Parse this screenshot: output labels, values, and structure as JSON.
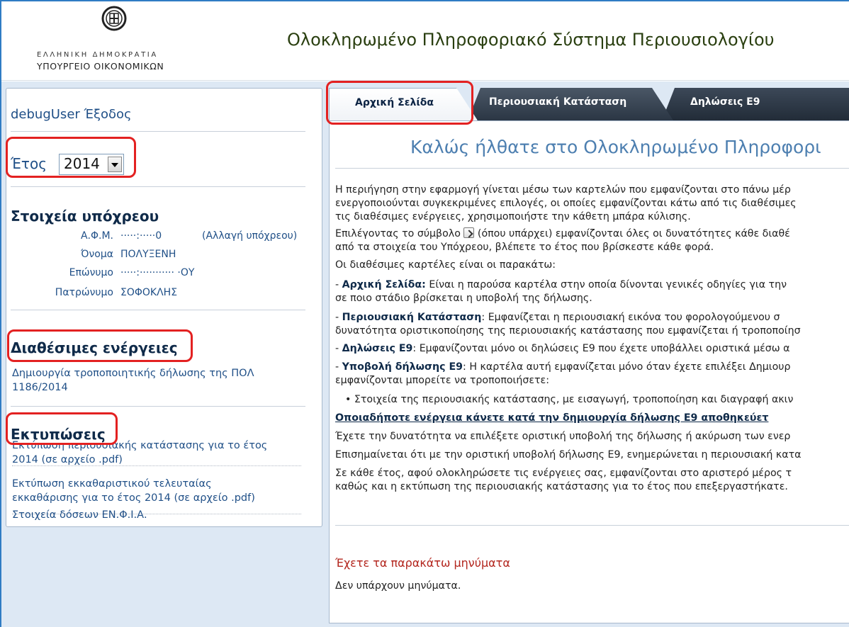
{
  "header": {
    "logo_line1": "ΕΛΛΗΝΙΚΗ ΔΗΜΟΚΡΑΤΙΑ",
    "logo_line2": "ΥΠΟΥΡΓΕΙΟ ΟΙΚΟΝΟΜΙΚΩΝ",
    "app_title": "Ολοκληρωμένο Πληροφοριακό Σύστημα Περιουσιολογίου"
  },
  "sidebar": {
    "user": "debugUser",
    "logout": "Έξοδος",
    "year_label": "Έτος",
    "year_value": "2014",
    "taxpayer_title": "Στοιχεία υπόχρεου",
    "taxpayer": {
      "afm_label": "Α.Φ.Μ.",
      "afm_value": "·····:·····0",
      "change_link": "(Αλλαγή υπόχρεου)",
      "name_label": "Όνομα",
      "name_value": "ΠΟΛΥΞΕΝΗ",
      "surname_label": "Επώνυμο",
      "surname_value": "·····:··········· ·ΟΥ",
      "father_label": "Πατρώνυμο",
      "father_value": "ΣΟΦΟΚΛΗΣ"
    },
    "actions_title": "Διαθέσιμες ενέργειες",
    "actions": [
      {
        "line1": "Δημιουργία τροποποιητικής δήλωσης της ΠΟΛ",
        "line2": "1186/2014"
      }
    ],
    "prints_title": "Εκτυπώσεις",
    "prints": [
      {
        "line1": "Εκτύπωση περιουσιακής κατάστασης για το έτος",
        "line2": "2014 (σε αρχείο .pdf)"
      },
      {
        "line1": "Εκτύπωση εκκαθαριστικού τελευταίας",
        "line2": "εκκαθάρισης για το έτος 2014 (σε αρχείο .pdf)"
      },
      {
        "line1": "Στοιχεία δόσεων ΕΝ.Φ.Ι.Α.",
        "line2": ""
      }
    ]
  },
  "tabs": [
    {
      "label": "Αρχική Σελίδα"
    },
    {
      "label": "Περιουσιακή Κατάσταση"
    },
    {
      "label": "Δηλώσεις Ε9"
    }
  ],
  "main": {
    "welcome": "Καλώς ήλθατε στο Ολοκληρωμένο Πληροφορι",
    "p1_l1": "Η περιήγηση στην εφαρμογή γίνεται μέσω των καρτελών που εμφανίζονται στο πάνω μέρ",
    "p1_l2": "ενεργοποιούνται συγκεκριμένες επιλογές, οι οποίες εμφανίζονται κάτω από τις διαθέσιμες",
    "p1_l3": "τις διαθέσιμες ενέργειες, χρησιμοποιήστε την κάθετη μπάρα κύλισης.",
    "p2_a": "Επιλέγοντας το σύμβολο",
    "p2_b": "(όπου υπάρχει) εμφανίζονται όλες οι δυνατότητες κάθε διαθέ",
    "p2_l2": "από τα στοιχεία του Υπόχρεου, βλέπετε το έτος που βρίσκεστε κάθε φορά.",
    "p3": "Οι διαθέσιμες καρτέλες είναι οι παρακάτω:",
    "p4_bold": "Αρχική Σελίδα:",
    "p4_rest": "Είναι η παρούσα καρτέλα στην οποία δίνονται γενικές οδηγίες για την",
    "p4_l2": "σε ποιο στάδιο βρίσκεται η υποβολή της δήλωσης.",
    "p5_bold": "Περιουσιακή Κατάσταση",
    "p5_rest": ": Εμφανίζεται η περιουσιακή εικόνα του φορολογούμενου σ",
    "p5_l2": "δυνατότητα οριστικοποίησης της περιουσιακής κατάστασης που εμφανίζεται ή τροποποίησ",
    "p6_bold": "Δηλώσεις Ε9",
    "p6_rest": ": Εμφανίζονται μόνο οι δηλώσεις Ε9 που έχετε υποβάλλει οριστικά μέσω α",
    "p7_bold": "Υποβολή δήλωσης Ε9",
    "p7_rest": ": Η καρτέλα αυτή εμφανίζεται μόνο όταν έχετε επιλέξει Δημιουρ",
    "p7_l2": "εμφανίζονται μπορείτε να τροποποιήσετε:",
    "bullet1": "Στοιχεία της περιουσιακής κατάστασης, με εισαγωγή, τροποποίηση και διαγραφή ακιν",
    "underlined": "Οποιαδήποτε ενέργεια κάνετε κατά την δημιουργία δήλωσης Ε9 αποθηκεύετ",
    "p8": "Έχετε την δυνατότητα να επιλέξετε οριστική υποβολή της δήλωσης ή ακύρωση των ενερ",
    "p9": "Επισημαίνεται ότι με την οριστική υποβολή δήλωσης Ε9, ενημερώνεται η περιουσιακή κατα",
    "p10_l1": "Σε κάθε έτος, αφού ολοκληρώσετε τις ενέργειες σας, εμφανίζονται στο αριστερό μέρος τ",
    "p10_l2": "καθώς και η εκτύπωση της περιουσιακής κατάστασης για το έτος που επεξεργαστήκατε.",
    "messages_title": "Έχετε τα παρακάτω μηνύματα",
    "messages_text": "Δεν υπάρχουν μηνύματα."
  }
}
